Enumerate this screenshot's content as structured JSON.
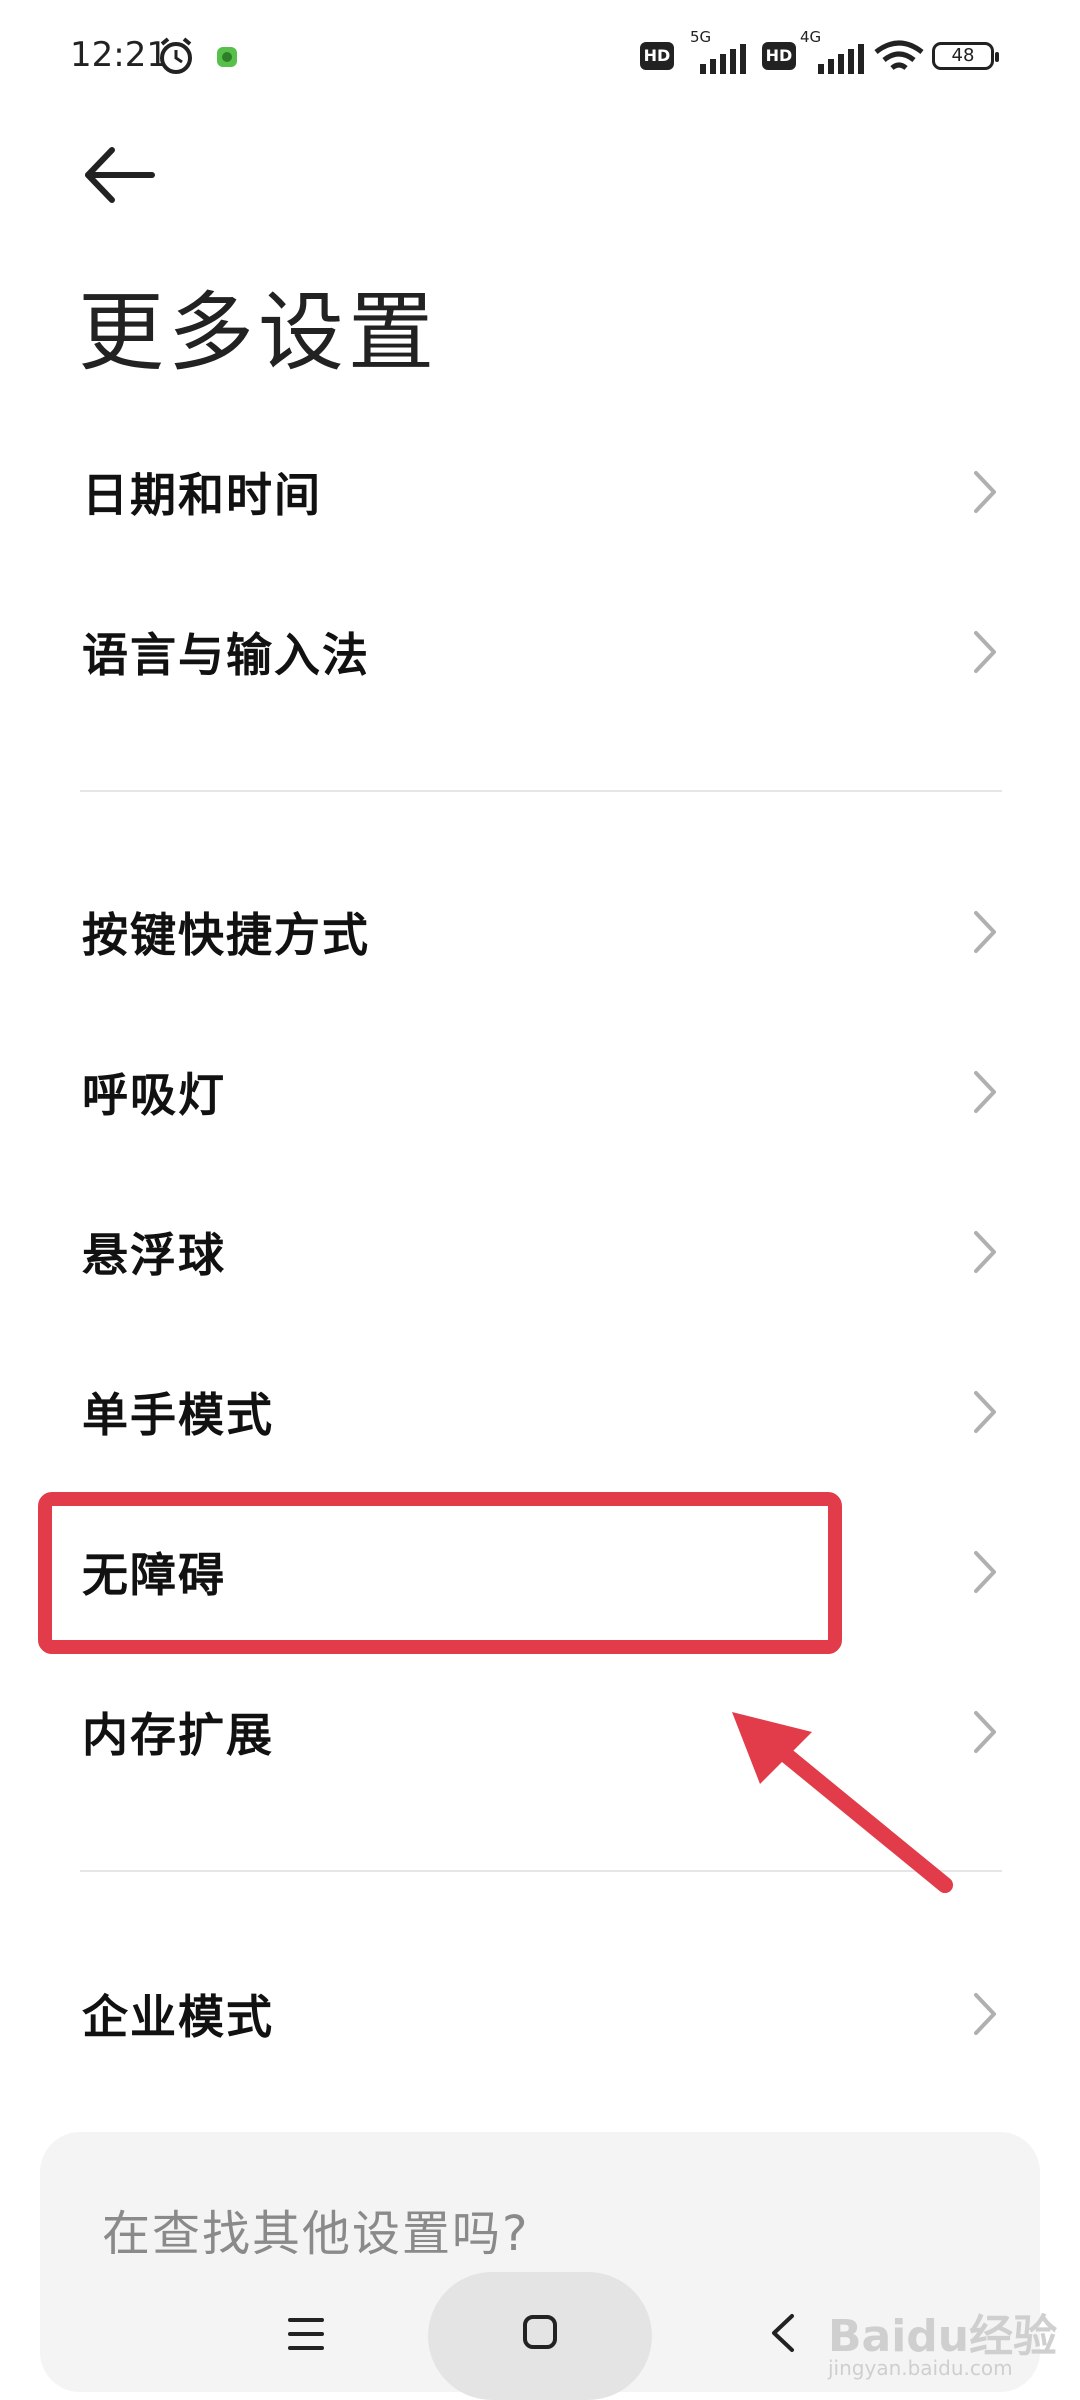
{
  "status_bar": {
    "time": "12:21",
    "hd1": "HD",
    "net1": "5G",
    "hd2": "HD",
    "net2": "4G",
    "battery": "48",
    "icons": [
      "alarm-icon",
      "app-notification-icon",
      "signal-icon",
      "wifi-icon",
      "battery-icon"
    ]
  },
  "page": {
    "title": "更多设置"
  },
  "groups": [
    {
      "items": [
        {
          "label": "日期和时间"
        },
        {
          "label": "语言与输入法"
        }
      ]
    },
    {
      "items": [
        {
          "label": "按键快捷方式"
        },
        {
          "label": "呼吸灯"
        },
        {
          "label": "悬浮球"
        },
        {
          "label": "单手模式"
        },
        {
          "label": "无障碍"
        },
        {
          "label": "内存扩展"
        }
      ]
    },
    {
      "items": [
        {
          "label": "企业模式"
        }
      ]
    }
  ],
  "search_card": {
    "text": "在查找其他设置吗?"
  },
  "annotation": {
    "highlight_color": "#e23b4a",
    "highlighted_item": "无障碍"
  },
  "watermark": {
    "main": "Baidu经验",
    "sub": "jingyan.baidu.com"
  }
}
